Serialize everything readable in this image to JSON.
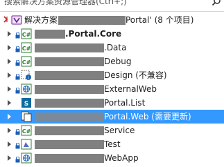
{
  "search": {
    "placeholder": "搜索解决方案资源管理器(Ctrl+;)"
  },
  "root": {
    "prefix": "解决方案",
    "suffix": "Portal' (8 个项目)"
  },
  "projects": [
    {
      "label": ".Portal.Core",
      "icon": "csharp-project-icon",
      "locked": true
    },
    {
      "label": ".Data",
      "icon": "csharp-project-icon",
      "locked": true
    },
    {
      "label": "Debug",
      "icon": "csharp-project-icon",
      "locked": true
    },
    {
      "label": "Design (不兼容)",
      "icon": "unloaded-project-icon",
      "locked": true
    },
    {
      "label": "ExternalWeb",
      "icon": "web-project-icon",
      "locked": true
    },
    {
      "label": "Portal.List",
      "icon": "sharepoint-project-icon",
      "locked": false
    },
    {
      "label": "Portal.Web (需要更新)",
      "icon": "web-project-update-icon",
      "locked": false,
      "selected": true
    },
    {
      "label": "Service",
      "icon": "csharp-project-icon",
      "locked": true
    },
    {
      "label": "Test",
      "icon": "test-project-icon",
      "locked": true
    },
    {
      "label": "WebApp",
      "icon": "web-project-icon",
      "locked": true
    }
  ],
  "colors": {
    "selection": "#3399ff",
    "redaction": "#808080",
    "csharp": "#2e7d32",
    "web": "#1a5fb4"
  }
}
